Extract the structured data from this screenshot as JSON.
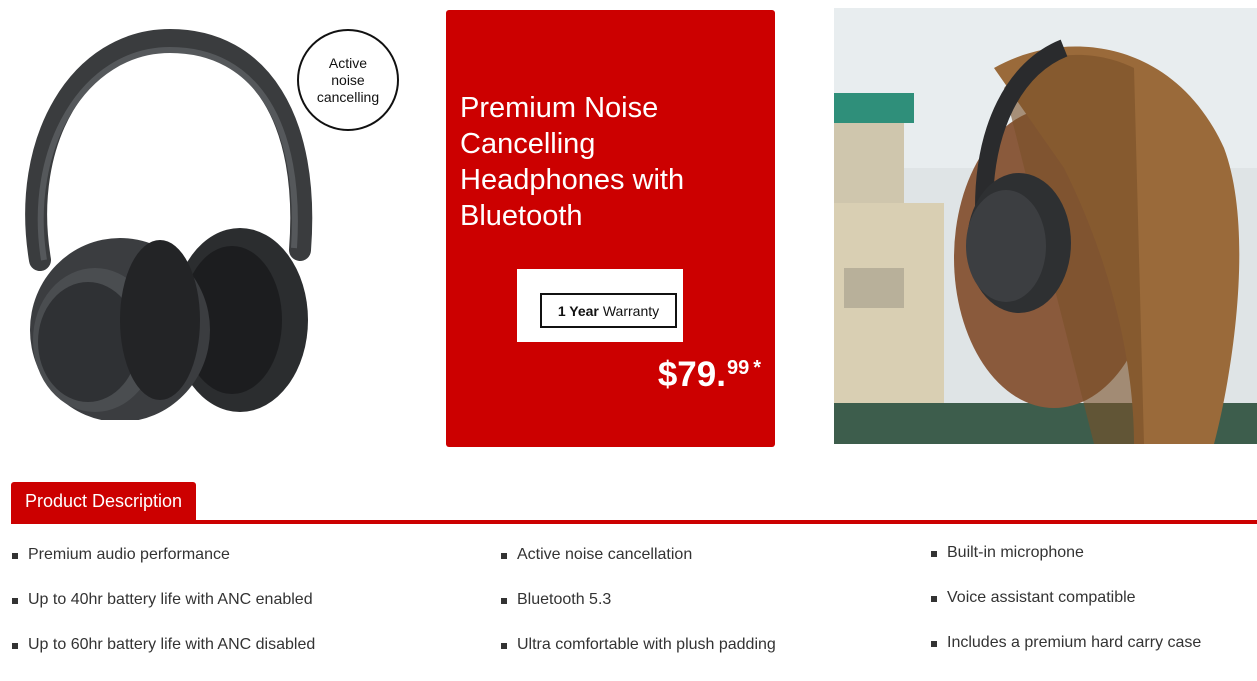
{
  "badge": {
    "text": "Active\nnoise\ncancelling"
  },
  "promo": {
    "title": "Premium Noise Cancelling Headphones with Bluetooth",
    "warranty_bold": "1 Year",
    "warranty_text": "Warranty",
    "price_main": "$79.",
    "price_cents": "99",
    "price_marker": "*"
  },
  "description": {
    "tab_label": "Product Description",
    "columns": [
      [
        "Premium audio performance",
        "Up to 40hr battery life with ANC enabled",
        "Up to 60hr battery life with ANC disabled"
      ],
      [
        "Active noise cancellation",
        "Bluetooth 5.3",
        "Ultra comfortable with plush padding"
      ],
      [
        "Built-in microphone",
        "Voice assistant compatible",
        "Includes a premium hard carry case"
      ]
    ]
  },
  "colors": {
    "accent": "#cc0000",
    "text": "#333333"
  },
  "icons": [
    "headphones-product-image",
    "lifestyle-photo"
  ]
}
